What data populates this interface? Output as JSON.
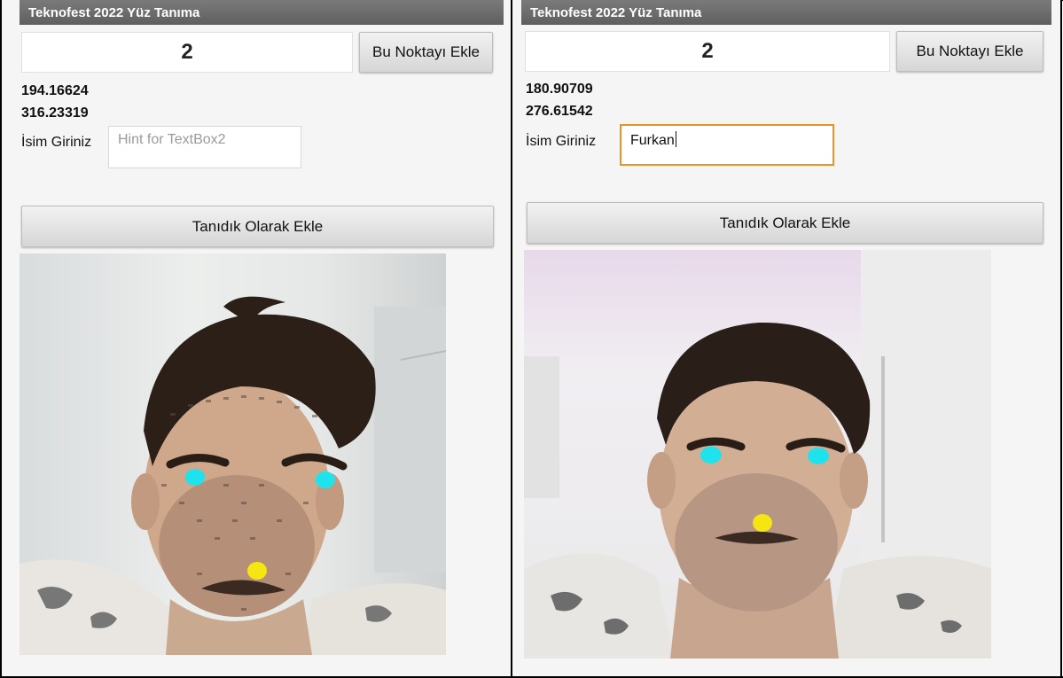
{
  "panels": [
    {
      "app_title": "Teknofest 2022 Yüz Tanıma",
      "point_index": "2",
      "add_point_label": "Bu Noktayı Ekle",
      "coord_x": "194.16624",
      "coord_y": "316.23319",
      "name_label": "İsim Giriniz",
      "name_input_value": "",
      "name_input_placeholder": "Hint for TextBox2",
      "add_known_label": "Tanıdık Olarak Ekle"
    },
    {
      "app_title": "Teknofest 2022 Yüz Tanıma",
      "point_index": "2",
      "add_point_label": "Bu Noktayı Ekle",
      "coord_x": "180.90709",
      "coord_y": "276.61542",
      "name_label": "İsim Giriniz",
      "name_input_value": "Furkan",
      "name_input_placeholder": "",
      "add_known_label": "Tanıdık Olarak Ekle"
    }
  ],
  "colors": {
    "eye_marker": "#1fe3ec",
    "nose_marker": "#f5e612",
    "focus_border": "#e8942a",
    "title_bar": "#6b6b6b"
  }
}
